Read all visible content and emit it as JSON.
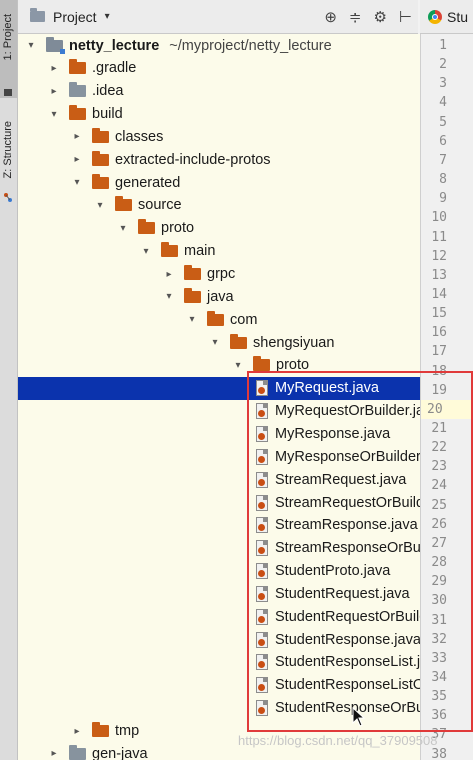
{
  "side_tabs": {
    "project": "1: Project",
    "structure": "Z: Structure"
  },
  "header": {
    "title": "Project",
    "caret": "▾",
    "tools": [
      "⊕",
      "≑",
      "⚙",
      "⊢"
    ]
  },
  "editor_tab": {
    "label": "Stu"
  },
  "tree": {
    "root_name": "netty_lecture",
    "root_path": "~/myproject/netty_lecture",
    "items": [
      {
        "label": "netty_lecture",
        "type": "module",
        "arrow": "▾",
        "depth": 0
      },
      {
        "label": ".gradle",
        "type": "folder",
        "arrow": "▸",
        "depth": 1
      },
      {
        "label": ".idea",
        "type": "folder-grey",
        "arrow": "▸",
        "depth": 1
      },
      {
        "label": "build",
        "type": "folder",
        "arrow": "▾",
        "depth": 1
      },
      {
        "label": "classes",
        "type": "folder",
        "arrow": "▸",
        "depth": 2
      },
      {
        "label": "extracted-include-protos",
        "type": "folder",
        "arrow": "▸",
        "depth": 2
      },
      {
        "label": "generated",
        "type": "folder",
        "arrow": "▾",
        "depth": 2
      },
      {
        "label": "source",
        "type": "folder",
        "arrow": "▾",
        "depth": 3
      },
      {
        "label": "proto",
        "type": "folder",
        "arrow": "▾",
        "depth": 4
      },
      {
        "label": "main",
        "type": "folder",
        "arrow": "▾",
        "depth": 5
      },
      {
        "label": "grpc",
        "type": "folder",
        "arrow": "▸",
        "depth": 6
      },
      {
        "label": "java",
        "type": "folder",
        "arrow": "▾",
        "depth": 6
      },
      {
        "label": "com",
        "type": "folder",
        "arrow": "▾",
        "depth": 7
      },
      {
        "label": "shengsiyuan",
        "type": "folder",
        "arrow": "▾",
        "depth": 8
      },
      {
        "label": "proto",
        "type": "folder",
        "arrow": "▾",
        "depth": 9
      },
      {
        "label": "MyRequest.java",
        "type": "file",
        "arrow": "",
        "depth": 10,
        "selected": true
      },
      {
        "label": "MyRequestOrBuilder.java",
        "type": "file",
        "arrow": "",
        "depth": 10
      },
      {
        "label": "MyResponse.java",
        "type": "file",
        "arrow": "",
        "depth": 10
      },
      {
        "label": "MyResponseOrBuilder.java",
        "type": "file",
        "arrow": "",
        "depth": 10
      },
      {
        "label": "StreamRequest.java",
        "type": "file",
        "arrow": "",
        "depth": 10
      },
      {
        "label": "StreamRequestOrBuilder.java",
        "type": "file",
        "arrow": "",
        "depth": 10
      },
      {
        "label": "StreamResponse.java",
        "type": "file",
        "arrow": "",
        "depth": 10
      },
      {
        "label": "StreamResponseOrBuilder.java",
        "type": "file",
        "arrow": "",
        "depth": 10
      },
      {
        "label": "StudentProto.java",
        "type": "file",
        "arrow": "",
        "depth": 10
      },
      {
        "label": "StudentRequest.java",
        "type": "file",
        "arrow": "",
        "depth": 10
      },
      {
        "label": "StudentRequestOrBuilder.java",
        "type": "file",
        "arrow": "",
        "depth": 10
      },
      {
        "label": "StudentResponse.java",
        "type": "file",
        "arrow": "",
        "depth": 10
      },
      {
        "label": "StudentResponseList.java",
        "type": "file",
        "arrow": "",
        "depth": 10
      },
      {
        "label": "StudentResponseListOrBuilder.java",
        "type": "file",
        "arrow": "",
        "depth": 10
      },
      {
        "label": "StudentResponseOrBuilder.java",
        "type": "file",
        "arrow": "",
        "depth": 10
      },
      {
        "label": "tmp",
        "type": "folder",
        "arrow": "▸",
        "depth": 2
      },
      {
        "label": "gen-java",
        "type": "folder-grey",
        "arrow": "▸",
        "depth": 1
      }
    ]
  },
  "gutter": {
    "lines": [
      "1",
      "2",
      "3",
      "4",
      "5",
      "6",
      "7",
      "8",
      "9",
      "10",
      "11",
      "12",
      "13",
      "14",
      "15",
      "16",
      "17",
      "18",
      "19",
      "20",
      "21",
      "22",
      "23",
      "24",
      "25",
      "26",
      "27",
      "28",
      "29",
      "30",
      "31",
      "32",
      "33",
      "34",
      "35",
      "36",
      "37",
      "38"
    ],
    "current_line": "20"
  },
  "watermark": "https://blog.csdn.net/qq_37909508",
  "colors": {
    "selection": "#0b33ad",
    "folder": "#c95d15",
    "highlight": "#e03a3a",
    "tree_bg": "#fcfbea"
  }
}
